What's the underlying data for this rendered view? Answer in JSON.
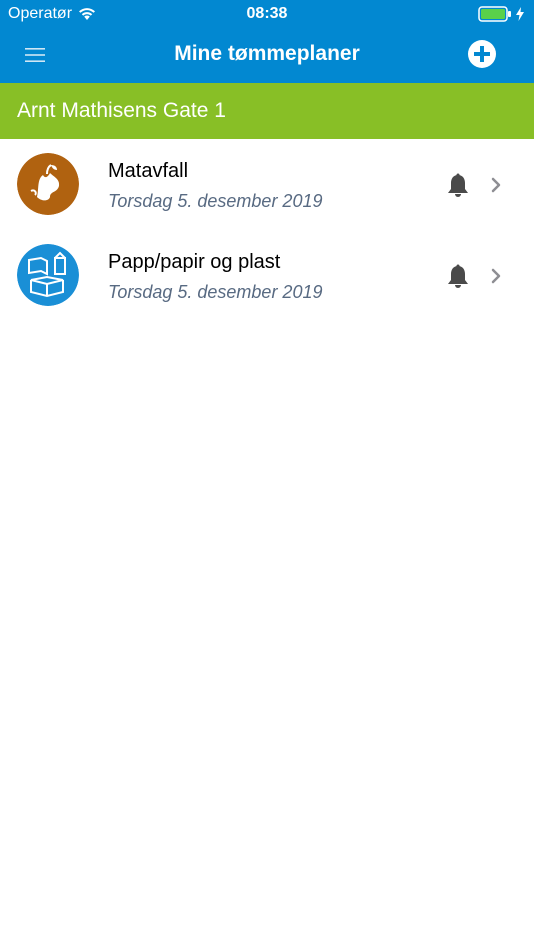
{
  "status_bar": {
    "carrier": "Operatør",
    "time": "08:38"
  },
  "nav": {
    "title": "Mine tømmeplaner",
    "menu_icon": "hamburger-icon",
    "add_icon": "plus-circle-icon"
  },
  "address": {
    "label": "Arnt Mathisens Gate 1"
  },
  "list": {
    "items": [
      {
        "title": "Matavfall",
        "date": "Torsdag 5. desember 2019",
        "icon": "food-waste-icon",
        "icon_color": "#b06210"
      },
      {
        "title": "Papp/papir og plast",
        "date": "Torsdag 5. desember 2019",
        "icon": "paper-plastic-icon",
        "icon_color": "#1a8fd6"
      }
    ]
  },
  "colors": {
    "header": "#0288d1",
    "address_bar": "#88bf26",
    "date_text": "#586a82"
  }
}
